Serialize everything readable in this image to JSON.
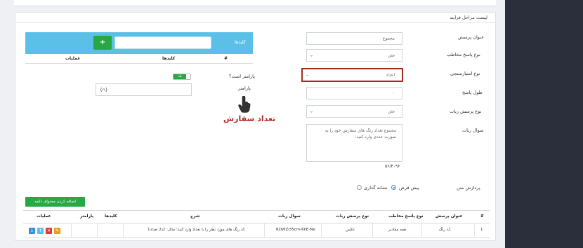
{
  "card_title": "لیست مراحل فرایند",
  "form": {
    "title_label": "عنوان پرسش",
    "title_value": "مجموع",
    "answer_type_label": "نوع پاسخ مخاطب",
    "answer_type_value": "متن",
    "scoring_type_label": "نوع امتیازسنجی",
    "scoring_type_value": "اعداد",
    "answer_length_label": "طول پاسخ",
    "answer_length_value": "۰",
    "bot_question_type_label": "نوع پرسش ربات",
    "bot_question_type_value": "متن",
    "bot_question_label": "سوال ربات",
    "bot_question_value": "مجموع تعداد رنگ های سفارش خود را به صورت عددی وارد کنید:",
    "char_counter": "۵۶/۴۰۹۶",
    "processing_label": "پردازش متن",
    "processing_option_default": "پیش فرض",
    "processing_option_tagging": "نشانه گذاری"
  },
  "keywords": {
    "title": "کلیدها",
    "add_icon": "+",
    "col_hash": "#",
    "col_keys": "کلیدها",
    "col_actions": "عملیات"
  },
  "param": {
    "is_param_label": "پارامتر است؟",
    "toggle_label": "بله",
    "param_label": "پارامتر",
    "param_value": "{n}"
  },
  "annotation": "تعداد سفارش",
  "add_content_button": "اضافه کردن محتوای دکمه",
  "table": {
    "headers": [
      "#",
      "عنوان پرسش",
      "نوع پاسخ مخاطب",
      "نوع پرسش ربات",
      "سوال ربات",
      "شرح",
      "کلیدها",
      "پارامتر",
      "عملیات"
    ],
    "row": {
      "index": "1",
      "title": "کد رنگ",
      "answer_type": "همه مقادیر",
      "bot_question_type": "عکس",
      "bot_question": "RDWZi35cm-KIiE-Ne",
      "description": "کد رنگ های مورد نظر را با تعداد وارد کنید؛ مثال: کد2 تعداد1"
    }
  },
  "colors": {
    "accent_blue": "#5bc0e8",
    "green": "#27a844",
    "highlight_red": "#a52a1f"
  },
  "icons": {
    "down": "arrow-down-icon",
    "up": "arrow-up-icon",
    "delete": "close-icon",
    "edit": "pencil-icon"
  }
}
